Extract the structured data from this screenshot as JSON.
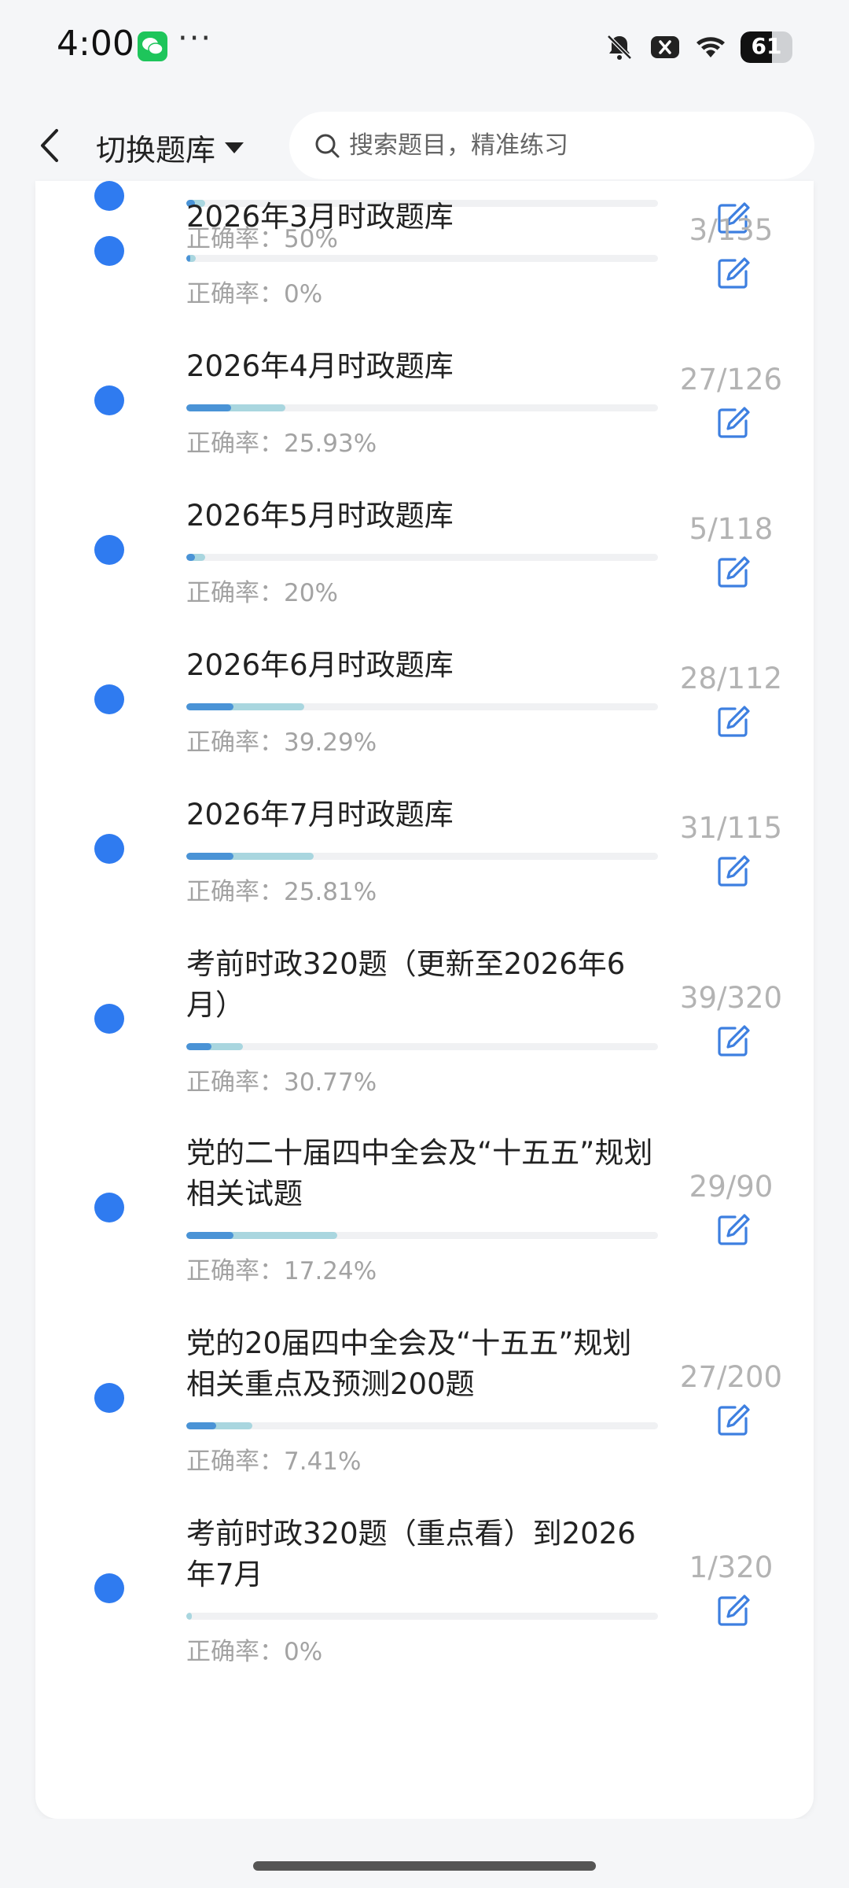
{
  "status_bar": {
    "time": "4:00",
    "more": "···",
    "battery": "61",
    "battery_level": 0.61,
    "icons": [
      "wechat-icon",
      "bell-muted-icon",
      "close-box-icon",
      "wifi-icon",
      "battery-icon"
    ]
  },
  "header": {
    "switch_label": "切换题库",
    "search_placeholder": "搜索题目，精准练习"
  },
  "colors": {
    "accent": "#2f7bf0",
    "progress_head": "#4a93d6",
    "progress_fill": "#a9d6df",
    "muted_text": "#a3a3a3"
  },
  "items": [
    {
      "title": "",
      "accuracy": "正确率：50%",
      "count": "",
      "progress": 0.04
    },
    {
      "title": "2026年3月时政题库",
      "accuracy": "正确率：0%",
      "count": "3/135",
      "progress": 0.02
    },
    {
      "title": "2026年4月时政题库",
      "accuracy": "正确率：25.93%",
      "count": "27/126",
      "progress": 0.21
    },
    {
      "title": "2026年5月时政题库",
      "accuracy": "正确率：20%",
      "count": "5/118",
      "progress": 0.04
    },
    {
      "title": "2026年6月时政题库",
      "accuracy": "正确率：39.29%",
      "count": "28/112",
      "progress": 0.25
    },
    {
      "title": "2026年7月时政题库",
      "accuracy": "正确率：25.81%",
      "count": "31/115",
      "progress": 0.27
    },
    {
      "title": "考前时政320题（更新至2026年6月）",
      "accuracy": "正确率：30.77%",
      "count": "39/320",
      "progress": 0.12
    },
    {
      "title": "党的二十届四中全会及“十五五”规划相关试题",
      "accuracy": "正确率：17.24%",
      "count": "29/90",
      "progress": 0.32
    },
    {
      "title": "党的20届四中全会及“十五五”规划相关重点及预测200题",
      "accuracy": "正确率：7.41%",
      "count": "27/200",
      "progress": 0.14
    },
    {
      "title": "考前时政320题（重点看）到2026年7月",
      "accuracy": "正确率：0%",
      "count": "1/320",
      "progress": 0.0
    }
  ]
}
